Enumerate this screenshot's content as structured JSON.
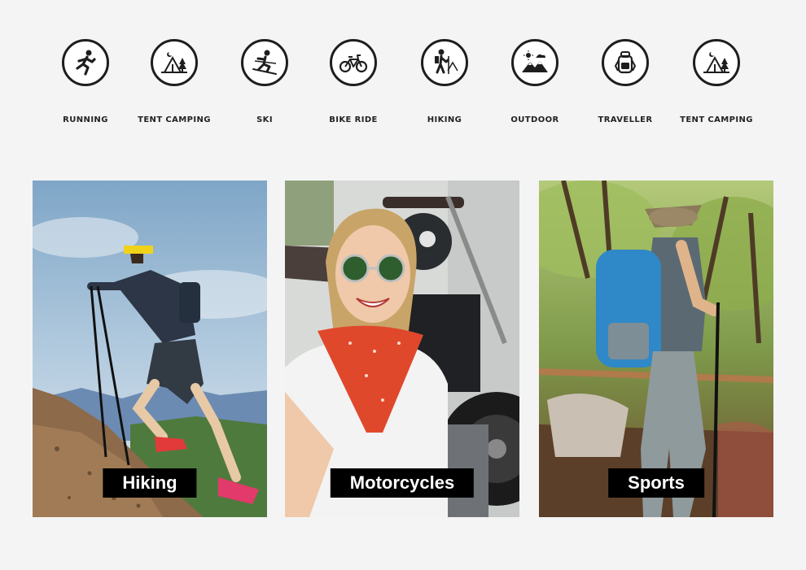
{
  "activities": [
    {
      "label": "RUNNING",
      "icon": "running-icon"
    },
    {
      "label": "TENT CAMPING",
      "icon": "tent-camping-icon"
    },
    {
      "label": "SKI",
      "icon": "ski-icon"
    },
    {
      "label": "BIKE RIDE",
      "icon": "bike-ride-icon"
    },
    {
      "label": "HIKING",
      "icon": "hiking-icon"
    },
    {
      "label": "OUTDOOR",
      "icon": "outdoor-icon"
    },
    {
      "label": "TRAVELLER",
      "icon": "traveller-icon"
    },
    {
      "label": "TENT CAMPING",
      "icon": "tent-camping-icon"
    }
  ],
  "panels": [
    {
      "caption": "Hiking",
      "photo": "hiker-on-mountain-photo"
    },
    {
      "caption": "Motorcycles",
      "photo": "woman-with-motorcycle-photo"
    },
    {
      "caption": "Sports",
      "photo": "hiker-in-forest-photo"
    }
  ]
}
